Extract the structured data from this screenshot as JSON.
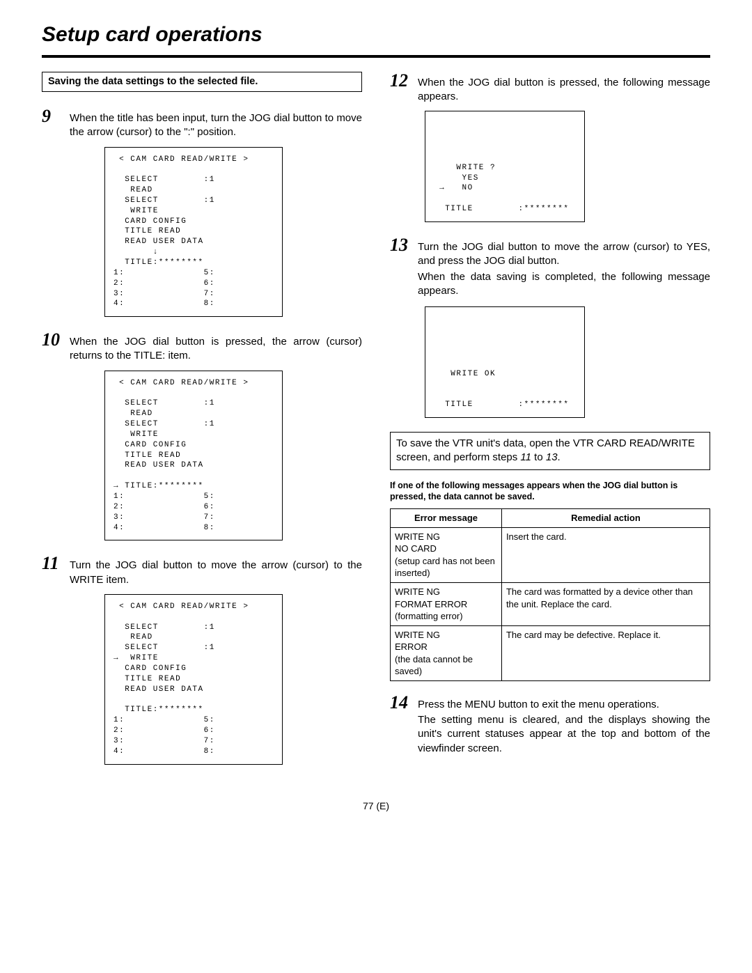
{
  "pageTitle": "Setup card operations",
  "subHeading": "Saving the data settings to the selected file.",
  "step9": {
    "num": "9",
    "text": "When the title has been input, turn the JOG dial button to move the arrow (cursor) to the \":\" position."
  },
  "screen9": " < CAM CARD READ/WRITE >\n\n  SELECT        :1\n   READ\n  SELECT        :1\n   WRITE\n  CARD CONFIG\n  TITLE READ\n  READ USER DATA\n       ↓\n  TITLE:********\n1:              5:\n2:              6:\n3:              7:\n4:              8:",
  "step10": {
    "num": "10",
    "text": "When the JOG dial button is pressed, the arrow (cursor) returns to the TITLE: item."
  },
  "screen10": " < CAM CARD READ/WRITE >\n\n  SELECT        :1\n   READ\n  SELECT        :1\n   WRITE\n  CARD CONFIG\n  TITLE READ\n  READ USER DATA\n\n→ TITLE:********\n1:              5:\n2:              6:\n3:              7:\n4:              8:",
  "step11": {
    "num": "11",
    "text": "Turn the JOG dial button to move the arrow (cursor) to the WRITE item."
  },
  "screen11": " < CAM CARD READ/WRITE >\n\n  SELECT        :1\n   READ\n  SELECT        :1\n→  WRITE\n  CARD CONFIG\n  TITLE READ\n  READ USER DATA\n\n  TITLE:********\n1:              5:\n2:              6:\n3:              7:\n4:              8:",
  "step12": {
    "num": "12",
    "text": "When the JOG dial button is pressed, the following message appears."
  },
  "screen12": "    WRITE ?\n     YES\n →   NO\n\n  TITLE        :********",
  "step13": {
    "num": "13",
    "text1": "Turn the JOG dial button to move the arrow (cursor) to YES, and press the JOG dial button.",
    "text2": "When the data saving is completed, the following message appears."
  },
  "screen13": "   WRITE OK\n\n\n  TITLE        :********",
  "noteBox": {
    "a": "To save the VTR unit's data, open the VTR CARD READ/WRITE screen, and perform steps ",
    "b": "11",
    "c": " to ",
    "d": "13",
    "e": "."
  },
  "condHead": "If one of the following messages appears when the JOG dial button is pressed, the data cannot be saved.",
  "table": {
    "h1": "Error message",
    "h2": "Remedial action",
    "r1c1": "WRITE NG\nNO CARD\n(setup card has not been inserted)",
    "r1c2": "Insert the card.",
    "r2c1": "WRITE NG\nFORMAT ERROR\n(formatting error)",
    "r2c2": "The card was formatted by a device other than the unit. Replace the card.",
    "r3c1": "WRITE NG\nERROR\n(the data cannot be saved)",
    "r3c2": "The card may be defective. Replace it."
  },
  "step14": {
    "num": "14",
    "text1": "Press the MENU button to exit the menu operations.",
    "text2": "The setting menu is cleared, and the displays showing the unit's current statuses appear at the top and bottom of the viewfinder screen."
  },
  "footer": "77 (E)"
}
